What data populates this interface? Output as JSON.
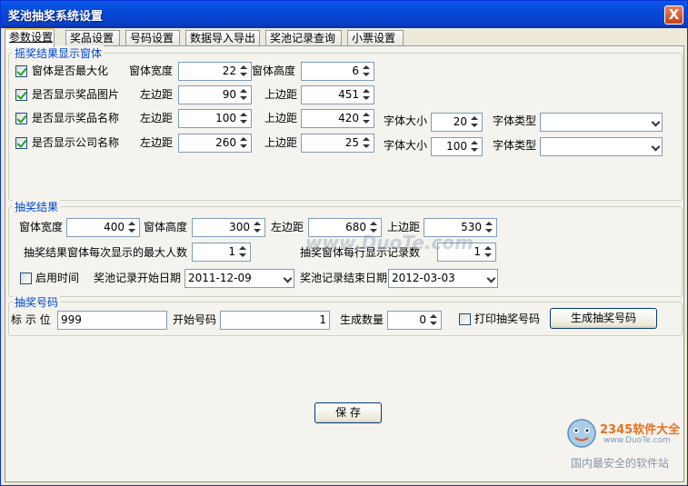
{
  "window": {
    "title": "奖池抽奖系统设置",
    "close": "X"
  },
  "tabs": [
    "参数设置",
    "奖品设置",
    "号码设置",
    "数据导入导出",
    "奖池记录查询",
    "小票设置"
  ],
  "group1": {
    "legend": "摇奖结果显示窗体",
    "rows": [
      {
        "check": "窗体是否最大化",
        "l1": "窗体宽度",
        "v1": "22",
        "l2": "窗体高度",
        "v2": "6"
      },
      {
        "check": "是否显示奖品图片",
        "l1": "左边距",
        "v1": "90",
        "l2": "上边距",
        "v2": "451"
      },
      {
        "check": "是否显示奖品名称",
        "l1": "左边距",
        "v1": "100",
        "l2": "上边距",
        "v2": "420",
        "l3": "字体大小",
        "v3": "20",
        "l4": "字体类型",
        "v4": ""
      },
      {
        "check": "是否显示公司名称",
        "l1": "左边距",
        "v1": "260",
        "l2": "上边距",
        "v2": "25",
        "l3": "字体大小",
        "v3": "100",
        "l4": "字体类型",
        "v4": ""
      }
    ]
  },
  "group2": {
    "legend": "抽奖结果",
    "width_label": "窗体宽度",
    "width": "400",
    "height_label": "窗体高度",
    "height": "300",
    "left_label": "左边距",
    "left": "680",
    "top_label": "上边距",
    "top": "530",
    "max_label": "抽奖结果窗体每次显示的最大人数",
    "max": "1",
    "row_label": "抽奖窗体每行显示记录数",
    "row": "1",
    "time_label": "启用时间",
    "start_label": "奖池记录开始日期",
    "start": "2011-12-09",
    "end_label": "奖池记录结束日期",
    "end": "2012-03-03"
  },
  "group3": {
    "legend": "抽奖号码",
    "mark_label": "标 示 位",
    "mark": "999",
    "start_label": "开始号码",
    "start": "1",
    "count_label": "生成数量",
    "count": "0",
    "print_label": "打印抽奖号码",
    "gen_button": "生成抽奖号码"
  },
  "save_button": "保 存",
  "watermark": {
    "site": "www.DuoTe.com",
    "brand": "2345软件大全",
    "url": "www.DuoTe.com",
    "slogan": "国内最安全的软件站"
  }
}
